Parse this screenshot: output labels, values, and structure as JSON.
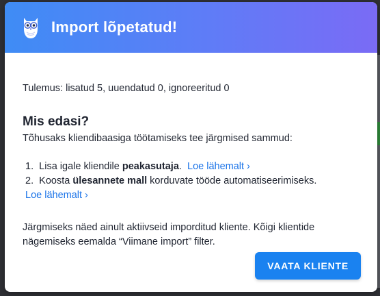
{
  "modal": {
    "title": "Import lõpetatud!",
    "result_text": "Tulemus: lisatud 5, uuendatud 0, ignoreeritud 0",
    "next_heading": "Mis edasi?",
    "next_intro": "Tõhusaks kliendibaasiga töötamiseks tee järgmised sammud:",
    "steps": [
      {
        "number": "1.",
        "text_before": "Lisa igale kliendile",
        "bold": "peakasutaja",
        "text_after": ".",
        "link": "Loe lähemalt ›"
      },
      {
        "number": "2.",
        "text_before": "Koosta",
        "bold": "ülesannete mall",
        "text_after": "korduvate tööde automatiseerimiseks.",
        "link": "Loe lähemalt ›"
      }
    ],
    "note": "Järgmiseks näed ainult aktiivseid imporditud kliente. Kõigi klientide nägemiseks eemalda “Viimane import” filter.",
    "primary_button": "VAATA KLIENTE"
  },
  "icons": {
    "logo": "owl-logo-icon"
  },
  "colors": {
    "header_gradient_start": "#3f8cf5",
    "header_gradient_end": "#7a6bf5",
    "link": "#1a73e8",
    "primary_button": "#1a82f0"
  }
}
